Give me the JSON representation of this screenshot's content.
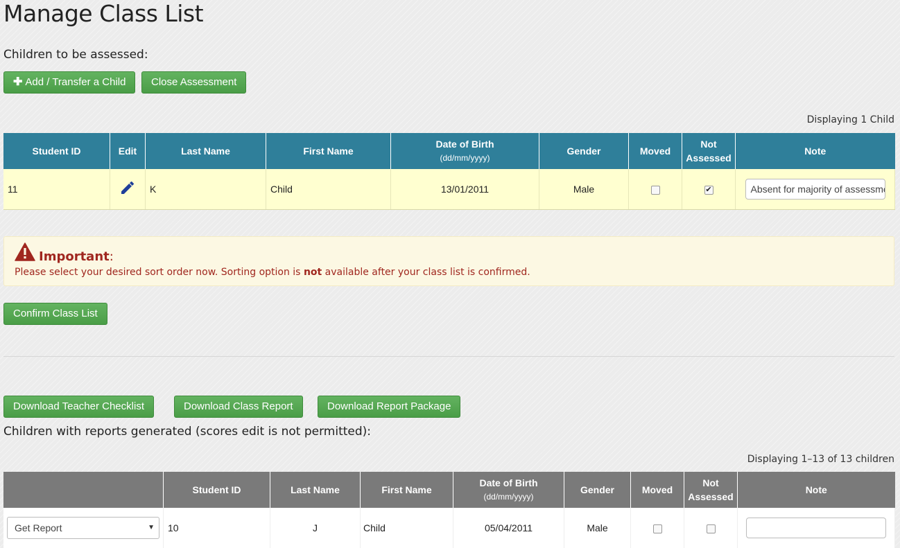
{
  "page_title": "Manage Class List",
  "assessed_section": {
    "title": "Children to be assessed:",
    "add_button": "Add / Transfer a Child",
    "close_button": "Close Assessment",
    "count_text": "Displaying 1 Child",
    "headers": {
      "student_id": "Student ID",
      "edit": "Edit",
      "last_name": "Last Name",
      "first_name": "First Name",
      "dob": "Date of Birth",
      "dob_format": "(dd/mm/yyyy)",
      "gender": "Gender",
      "moved": "Moved",
      "not": "Not",
      "assessed": "Assessed",
      "note": "Note"
    },
    "rows": [
      {
        "student_id": "11",
        "last_name": "K",
        "first_name": "Child",
        "dob": "13/01/2011",
        "gender": "Male",
        "moved": false,
        "not_assessed": true,
        "note": "Absent for majority of assessment"
      }
    ]
  },
  "alert": {
    "title": "Important",
    "colon": ":",
    "msg_before": "Please select your desired sort order now. Sorting option is ",
    "msg_bold": "not",
    "msg_after": " available after your class list is confirmed."
  },
  "confirm_button": "Confirm Class List",
  "download_buttons": {
    "teacher_checklist": "Download Teacher Checklist",
    "class_report": "Download Class Report",
    "report_package": "Download Report Package"
  },
  "reports_section": {
    "title": "Children with reports generated (scores edit is not permitted):",
    "count_text": "Displaying 1–13 of 13 children",
    "headers": {
      "student_id": "Student ID",
      "last_name": "Last Name",
      "first_name": "First Name",
      "dob": "Date of Birth",
      "dob_format": "(dd/mm/yyyy)",
      "gender": "Gender",
      "moved": "Moved",
      "not": "Not",
      "assessed": "Assessed",
      "note": "Note"
    },
    "rows": [
      {
        "action": "Get Report",
        "student_id": "10",
        "last_name": "J",
        "first_name": "Child",
        "dob": "05/04/2011",
        "gender": "Male",
        "moved": false,
        "not_assessed": false,
        "note": ""
      }
    ]
  },
  "icons": {
    "edit": "pencil-icon",
    "warning": "warning-triangle-icon",
    "add": "plus-icon",
    "dropdown": "caret-down-icon"
  },
  "colors": {
    "header_blue": "#2f7f9a",
    "header_gray": "#7a7a7a",
    "button_green": "#5cb85c",
    "row_highlight": "#ffffd0",
    "alert_text": "#a0271f"
  }
}
